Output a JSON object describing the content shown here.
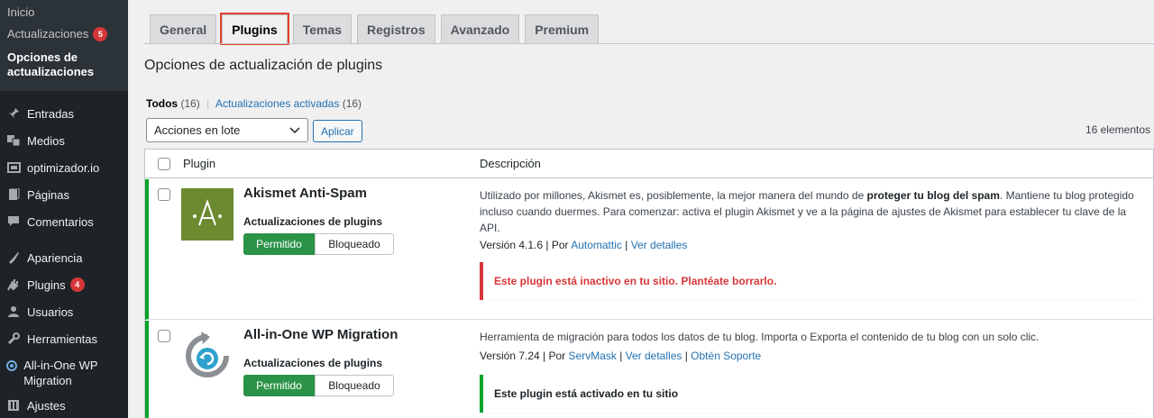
{
  "sidebar": {
    "submenu": [
      {
        "label": "Inicio"
      },
      {
        "label": "Actualizaciones",
        "badge": "5"
      },
      {
        "label": "Opciones de actualizaciones"
      }
    ],
    "menu": [
      {
        "label": "Entradas",
        "icon": "pushpin-icon"
      },
      {
        "label": "Medios",
        "icon": "media-icon"
      },
      {
        "label": "optimizador.io",
        "icon": "optimizer-icon"
      },
      {
        "label": "Páginas",
        "icon": "pages-icon"
      },
      {
        "label": "Comentarios",
        "icon": "comments-icon"
      },
      {
        "label": "Apariencia",
        "icon": "appearance-icon"
      },
      {
        "label": "Plugins",
        "icon": "plugins-icon",
        "badge": "4"
      },
      {
        "label": "Usuarios",
        "icon": "users-icon"
      },
      {
        "label": "Herramientas",
        "icon": "tools-icon"
      },
      {
        "label": "All-in-One WP Migration",
        "icon": "migration-icon"
      },
      {
        "label": "Ajustes",
        "icon": "settings-icon"
      }
    ]
  },
  "tabs": [
    {
      "label": "General"
    },
    {
      "label": "Plugins",
      "active": true
    },
    {
      "label": "Temas"
    },
    {
      "label": "Registros"
    },
    {
      "label": "Avanzado"
    },
    {
      "label": "Premium"
    }
  ],
  "page_title": "Opciones de actualización de plugins",
  "filters": {
    "all_label": "Todos",
    "all_count": "(16)",
    "separator": "|",
    "enabled_label": "Actualizaciones activadas",
    "enabled_count": "(16)"
  },
  "bulk": {
    "selected": "Acciones en lote",
    "apply_label": "Aplicar"
  },
  "item_count": "16 elementos",
  "table": {
    "col_plugin": "Plugin",
    "col_description": "Descripción"
  },
  "plugins": [
    {
      "name": "Akismet Anti-Spam",
      "updates_label": "Actualizaciones de plugins",
      "allowed_label": "Permitido",
      "blocked_label": "Bloqueado",
      "desc_pre": "Utilizado por millones, Akismet es, posiblemente, la mejor manera del mundo de ",
      "desc_bold": "proteger tu blog del spam",
      "desc_post": ". Mantiene tu blog protegido incluso cuando duermes. Para comenzar: activa el plugin Akismet y ve a la página de ajustes de Akismet para establecer tu clave de la API.",
      "version": "Versión 4.1.6 | Por ",
      "author": "Automattic",
      "sep": " | ",
      "details": "Ver detalles",
      "notice": "Este plugin está inactivo en tu sitio. Plantéate borrarlo.",
      "colors": {
        "logo_bg": "#6c8a2f",
        "notice_border": "#d63638"
      }
    },
    {
      "name": "All-in-One WP Migration",
      "updates_label": "Actualizaciones de plugins",
      "allowed_label": "Permitido",
      "blocked_label": "Bloqueado",
      "desc": "Herramienta de migración para todos los datos de tu blog. Importa o Exporta el contenido de tu blog con un solo clic.",
      "version": "Versión 7.24 | Por ",
      "author": "ServMask",
      "sep": " | ",
      "details": "Ver detalles",
      "sep2": " | ",
      "support": "Obtén Soporte",
      "notice": "Este plugin está activado en tu sitio",
      "colors": {
        "notice_border": "#00a32a"
      }
    }
  ]
}
